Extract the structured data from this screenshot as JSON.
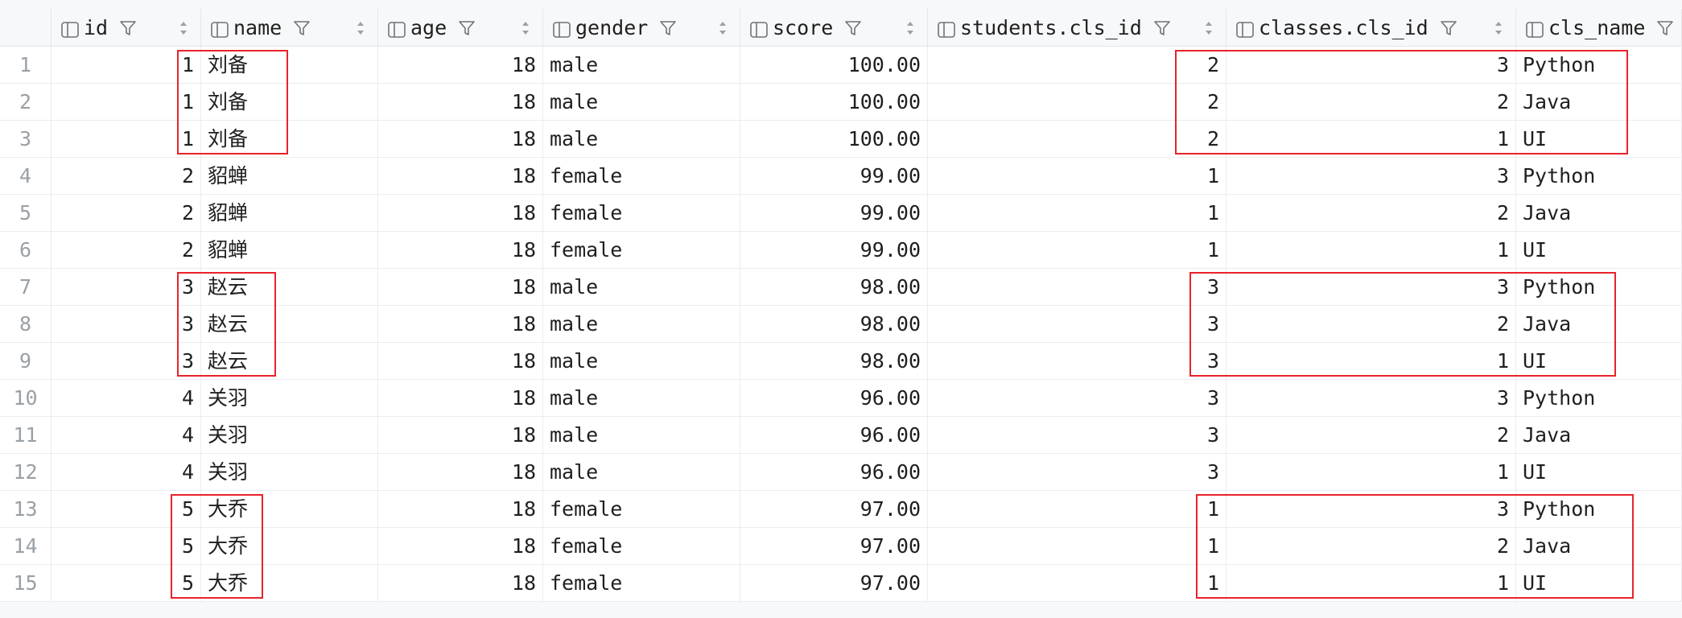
{
  "columns": [
    {
      "key": "id",
      "label": "id",
      "align": "num"
    },
    {
      "key": "name",
      "label": "name",
      "align": "txt"
    },
    {
      "key": "age",
      "label": "age",
      "align": "num"
    },
    {
      "key": "gender",
      "label": "gender",
      "align": "txt"
    },
    {
      "key": "score",
      "label": "score",
      "align": "num"
    },
    {
      "key": "students_cls_id",
      "label": "students.cls_id",
      "align": "num"
    },
    {
      "key": "classes_cls_id",
      "label": "classes.cls_id",
      "align": "num"
    },
    {
      "key": "cls_name",
      "label": "cls_name",
      "align": "txt"
    }
  ],
  "rows": [
    {
      "n": "1",
      "id": "1",
      "name": "刘备",
      "age": "18",
      "gender": "male",
      "score": "100.00",
      "students_cls_id": "2",
      "classes_cls_id": "3",
      "cls_name": "Python"
    },
    {
      "n": "2",
      "id": "1",
      "name": "刘备",
      "age": "18",
      "gender": "male",
      "score": "100.00",
      "students_cls_id": "2",
      "classes_cls_id": "2",
      "cls_name": "Java"
    },
    {
      "n": "3",
      "id": "1",
      "name": "刘备",
      "age": "18",
      "gender": "male",
      "score": "100.00",
      "students_cls_id": "2",
      "classes_cls_id": "1",
      "cls_name": "UI"
    },
    {
      "n": "4",
      "id": "2",
      "name": "貂蝉",
      "age": "18",
      "gender": "female",
      "score": "99.00",
      "students_cls_id": "1",
      "classes_cls_id": "3",
      "cls_name": "Python"
    },
    {
      "n": "5",
      "id": "2",
      "name": "貂蝉",
      "age": "18",
      "gender": "female",
      "score": "99.00",
      "students_cls_id": "1",
      "classes_cls_id": "2",
      "cls_name": "Java"
    },
    {
      "n": "6",
      "id": "2",
      "name": "貂蝉",
      "age": "18",
      "gender": "female",
      "score": "99.00",
      "students_cls_id": "1",
      "classes_cls_id": "1",
      "cls_name": "UI"
    },
    {
      "n": "7",
      "id": "3",
      "name": "赵云",
      "age": "18",
      "gender": "male",
      "score": "98.00",
      "students_cls_id": "3",
      "classes_cls_id": "3",
      "cls_name": "Python"
    },
    {
      "n": "8",
      "id": "3",
      "name": "赵云",
      "age": "18",
      "gender": "male",
      "score": "98.00",
      "students_cls_id": "3",
      "classes_cls_id": "2",
      "cls_name": "Java"
    },
    {
      "n": "9",
      "id": "3",
      "name": "赵云",
      "age": "18",
      "gender": "male",
      "score": "98.00",
      "students_cls_id": "3",
      "classes_cls_id": "1",
      "cls_name": "UI"
    },
    {
      "n": "10",
      "id": "4",
      "name": "关羽",
      "age": "18",
      "gender": "male",
      "score": "96.00",
      "students_cls_id": "3",
      "classes_cls_id": "3",
      "cls_name": "Python"
    },
    {
      "n": "11",
      "id": "4",
      "name": "关羽",
      "age": "18",
      "gender": "male",
      "score": "96.00",
      "students_cls_id": "3",
      "classes_cls_id": "2",
      "cls_name": "Java"
    },
    {
      "n": "12",
      "id": "4",
      "name": "关羽",
      "age": "18",
      "gender": "male",
      "score": "96.00",
      "students_cls_id": "3",
      "classes_cls_id": "1",
      "cls_name": "UI"
    },
    {
      "n": "13",
      "id": "5",
      "name": "大乔",
      "age": "18",
      "gender": "female",
      "score": "97.00",
      "students_cls_id": "1",
      "classes_cls_id": "3",
      "cls_name": "Python"
    },
    {
      "n": "14",
      "id": "5",
      "name": "大乔",
      "age": "18",
      "gender": "female",
      "score": "97.00",
      "students_cls_id": "1",
      "classes_cls_id": "2",
      "cls_name": "Java"
    },
    {
      "n": "15",
      "id": "5",
      "name": "大乔",
      "age": "18",
      "gender": "female",
      "score": "97.00",
      "students_cls_id": "1",
      "classes_cls_id": "1",
      "cls_name": "UI"
    }
  ],
  "highlights": [
    {
      "group": "id-name",
      "rows": [
        1,
        3
      ]
    },
    {
      "group": "cls",
      "rows": [
        1,
        3
      ]
    },
    {
      "group": "id-name",
      "rows": [
        7,
        9
      ]
    },
    {
      "group": "cls",
      "rows": [
        7,
        9
      ]
    },
    {
      "group": "id-name",
      "rows": [
        13,
        15
      ]
    },
    {
      "group": "cls",
      "rows": [
        13,
        15
      ]
    }
  ],
  "icons": {
    "column": "column-icon",
    "filter": "filter-icon",
    "sort": "sort-icon"
  },
  "colors": {
    "highlight": "#e8232b",
    "header_bg": "#f7f8fa",
    "row_number": "#9aa0a6",
    "grid_line": "#ebecf0"
  }
}
